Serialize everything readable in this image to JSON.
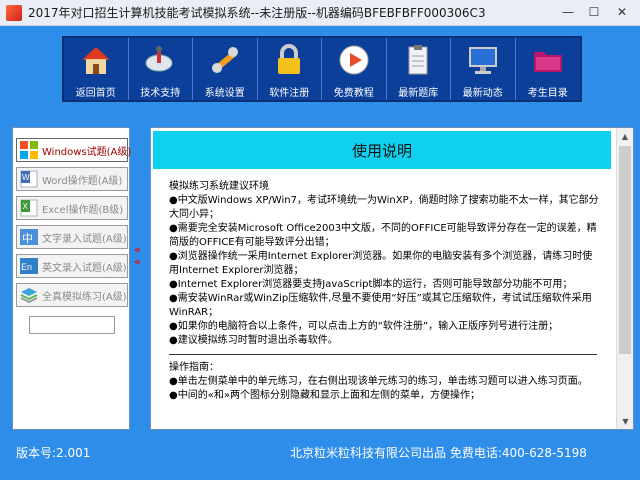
{
  "window": {
    "title": "2017年对口招生计算机技能考试模拟系统--未注册版--机器编码BFEBFBFF000306C3",
    "minimize": "—",
    "maximize": "☐",
    "close": "✕"
  },
  "toolbar": {
    "items": [
      {
        "label": "返回首页",
        "icon": "home-icon"
      },
      {
        "label": "技术支持",
        "icon": "satellite-icon"
      },
      {
        "label": "系统设置",
        "icon": "wrench-icon"
      },
      {
        "label": "软件注册",
        "icon": "lock-icon"
      },
      {
        "label": "免费教程",
        "icon": "play-icon"
      },
      {
        "label": "最新题库",
        "icon": "document-icon"
      },
      {
        "label": "最新动态",
        "icon": "monitor-icon"
      },
      {
        "label": "考生目录",
        "icon": "folder-icon"
      }
    ]
  },
  "sidebar": {
    "items": [
      {
        "label": "Windows试题(A级)",
        "icon": "windows-icon",
        "active": true
      },
      {
        "label": "Word操作题(A级)",
        "icon": "word-icon",
        "active": false
      },
      {
        "label": "Excel操作题(B级)",
        "icon": "excel-icon",
        "active": false
      },
      {
        "label": "文字录入试题(A级)",
        "icon": "chinese-input-icon",
        "active": false
      },
      {
        "label": "英文录入试题(A级)",
        "icon": "english-input-icon",
        "active": false
      },
      {
        "label": "全真模拟练习(A级)",
        "icon": "layers-icon",
        "active": false
      }
    ],
    "input_value": "",
    "arrow_glyph": "«"
  },
  "main": {
    "title": "使用说明",
    "section1_title": "模拟练习系统建议环境",
    "section1_lines": [
      "●中文版Windows XP/Win7，考试环境统一为WinXP，倘题时除了搜索功能不太一样，其它部分大同小异；",
      "●需要完全安装Microsoft Office2003中文版，不同的OFFICE可能导致评分存在一定的误差，精简版的OFFICE有可能导致评分出错；",
      "●浏览器操作统一采用Internet Explorer浏览器。如果你的电脑安装有多个浏览器，请练习时使用Internet Explorer浏览器；",
      "●Internet Explorer浏览器要支持JavaScript脚本的运行，否则可能导致部分功能不可用；",
      "●需安装WinRar或WinZip压缩软件,尽量不要使用“好压”或其它压缩软件，考试试压缩软件采用WinRAR；",
      "●如果你的电脑符合以上条件，可以点击上方的“软件注册”，输入正版序列号进行注册；",
      "●建议模拟练习时暂时退出杀毒软件。"
    ],
    "section2_title": "操作指南：",
    "section2_lines": [
      "●单击左侧菜单中的单元练习，在右侧出现该单元练习的练习，单击练习题可以进入练习页面。",
      "●中间的«和»两个图标分别隐藏和显示上面和左侧的菜单，方便操作；"
    ]
  },
  "status": {
    "version": "版本号:2.001",
    "company": "北京粒米粒科技有限公司出品  免费电话:400-628-5198"
  },
  "colors": {
    "background": "#2e8de8",
    "toolbar": "#0b3f9a",
    "title_band": "#0fd0ee",
    "active_text": "#a10000"
  }
}
